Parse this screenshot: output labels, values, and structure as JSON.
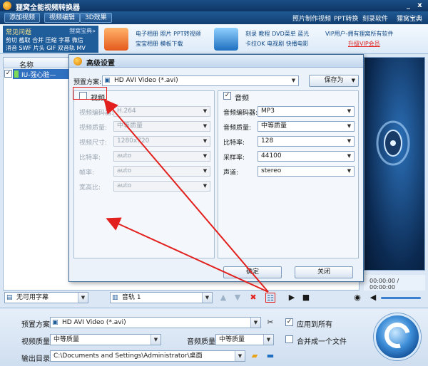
{
  "window": {
    "title": "狸窝全能视频转换器",
    "min": "_",
    "close": "x"
  },
  "toolbar": {
    "buttons": [
      "添加视频",
      "视频编辑",
      "3D效果"
    ],
    "links": [
      "照片制作视频",
      "PPT转换",
      "刻录软件",
      "狸窝宝典"
    ]
  },
  "banner": {
    "faq_title": "常见问题",
    "faq_right": "狸窝宝典»",
    "faq_rows": [
      "剪切 截取 合并 压缩 字幕 微信",
      "消音 SWF 片头 GIF 双音轨 MV"
    ],
    "ad1": [
      "电子相册 照片 PPT转视频",
      "宝宝相册 模板下载"
    ],
    "ad2": [
      "刻录 教程 DVD菜单 蓝光",
      "卡拉OK 电视剧 快播电影"
    ],
    "vip": "VIP用户-拥有狸窝所有软件",
    "vip_link": "升级VIP会员"
  },
  "file_list": {
    "header_name": "名称",
    "header_settings_icon": "settings-icon",
    "file_name": "IU-强心脏—"
  },
  "preview": {
    "time": "00:00:00 / 00:00:00"
  },
  "controls": {
    "subtitle": "无可用字幕",
    "audio_track": "音轨 1"
  },
  "settings": {
    "preset_label": "预置方案:",
    "preset_value": "HD AVI Video (*.avi)",
    "apply_all": "应用到所有",
    "video_quality_label": "视频质量:",
    "video_quality_value": "中等质量",
    "audio_quality_label": "音频质量:",
    "audio_quality_value": "中等质量",
    "merge_label": "合并成一个文件",
    "output_label": "输出目录:",
    "output_value": "C:\\Documents and Settings\\Administrator\\桌面"
  },
  "dialog": {
    "title": "高级设置",
    "preset_label": "预置方案:",
    "preset_value": "HD AVI Video (*.avi)",
    "save_as": "保存为",
    "video_section": "视频",
    "video_fields": [
      {
        "label": "视频编码器:",
        "value": "H.264"
      },
      {
        "label": "视频质量:",
        "value": "中等质量"
      },
      {
        "label": "视频尺寸:",
        "value": "1280x720"
      },
      {
        "label": "比特率:",
        "value": "auto"
      },
      {
        "label": "帧率:",
        "value": "auto"
      },
      {
        "label": "宽高比:",
        "value": "auto"
      }
    ],
    "audio_section": "音频",
    "audio_fields": [
      {
        "label": "音频编码器:",
        "value": "MP3"
      },
      {
        "label": "音频质量:",
        "value": "中等质量"
      },
      {
        "label": "比特率:",
        "value": "128"
      },
      {
        "label": "采样率:",
        "value": "44100"
      },
      {
        "label": "声道:",
        "value": "stereo"
      }
    ],
    "ok": "确定",
    "close": "关闭"
  },
  "colors": {
    "annotation": "#e2201d",
    "title_bar": "#1b4f86",
    "vip_link": "#e2201d"
  }
}
